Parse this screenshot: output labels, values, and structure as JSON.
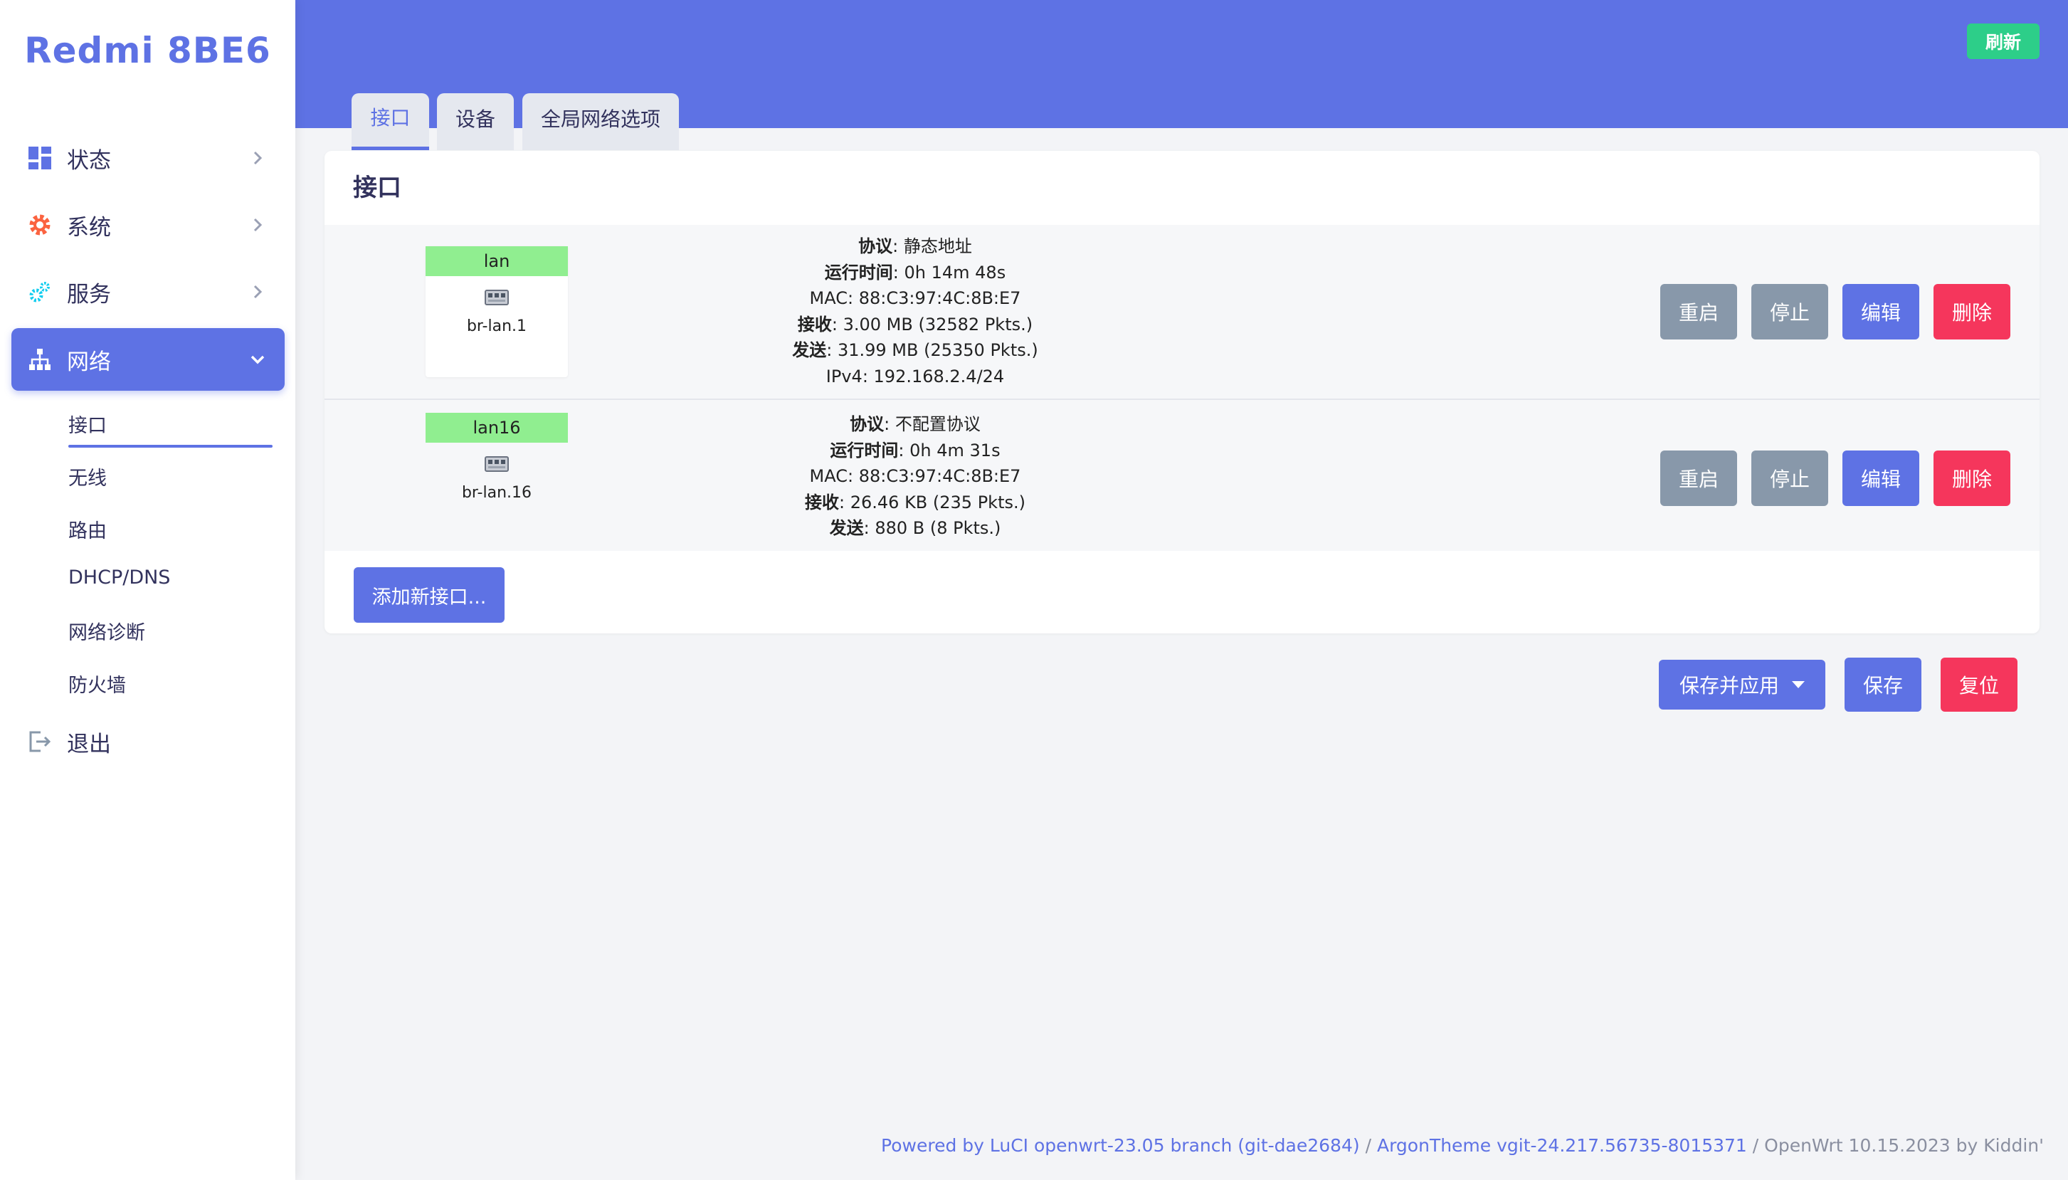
{
  "brand": "Redmi 8BE6",
  "sidebar": {
    "items": [
      {
        "label": "状态",
        "icon": "dashboard-icon"
      },
      {
        "label": "系统",
        "icon": "gear-icon"
      },
      {
        "label": "服务",
        "icon": "services-icon"
      },
      {
        "label": "网络",
        "icon": "network-icon"
      }
    ],
    "network_sub": [
      "接口",
      "无线",
      "路由",
      "DHCP/DNS",
      "网络诊断",
      "防火墙"
    ],
    "logout": "退出"
  },
  "header": {
    "refresh": "刷新",
    "tabs": [
      "接口",
      "设备",
      "全局网络选项"
    ]
  },
  "panel": {
    "title": "接口",
    "interfaces": [
      {
        "name": "lan",
        "device": "br-lan.1",
        "protocol_label": "协议",
        "protocol": "静态地址",
        "uptime_label": "运行时间",
        "uptime": "0h 14m 48s",
        "mac": "MAC: 88:C3:97:4C:8B:E7",
        "rx_label": "接收",
        "rx": "3.00 MB (32582 Pkts.)",
        "tx_label": "发送",
        "tx": "31.99 MB (25350 Pkts.)",
        "ipv4": "IPv4: 192.168.2.4/24"
      },
      {
        "name": "lan16",
        "device": "br-lan.16",
        "protocol_label": "协议",
        "protocol": "不配置协议",
        "uptime_label": "运行时间",
        "uptime": "0h 4m 31s",
        "mac": "MAC: 88:C3:97:4C:8B:E7",
        "rx_label": "接收",
        "rx": "26.46 KB (235 Pkts.)",
        "tx_label": "发送",
        "tx": "880 B (8 Pkts.)"
      }
    ],
    "row_buttons": {
      "restart": "重启",
      "stop": "停止",
      "edit": "编辑",
      "delete": "删除"
    },
    "add_interface": "添加新接口..."
  },
  "actions": {
    "save_apply": "保存并应用",
    "save": "保存",
    "reset": "复位"
  },
  "footer": {
    "part1": "Powered by LuCI openwrt-23.05 branch (git-dae2684)",
    "sep1": " / ",
    "part2": "ArgonTheme vgit-24.217.56735-8015371",
    "part3": " / OpenWrt 10.15.2023 by Kiddin'"
  },
  "colors": {
    "primary": "#5e72e4",
    "success": "#2dce89",
    "danger": "#f5365c",
    "neutral": "#8898aa",
    "iface_tag": "#90ee90"
  }
}
